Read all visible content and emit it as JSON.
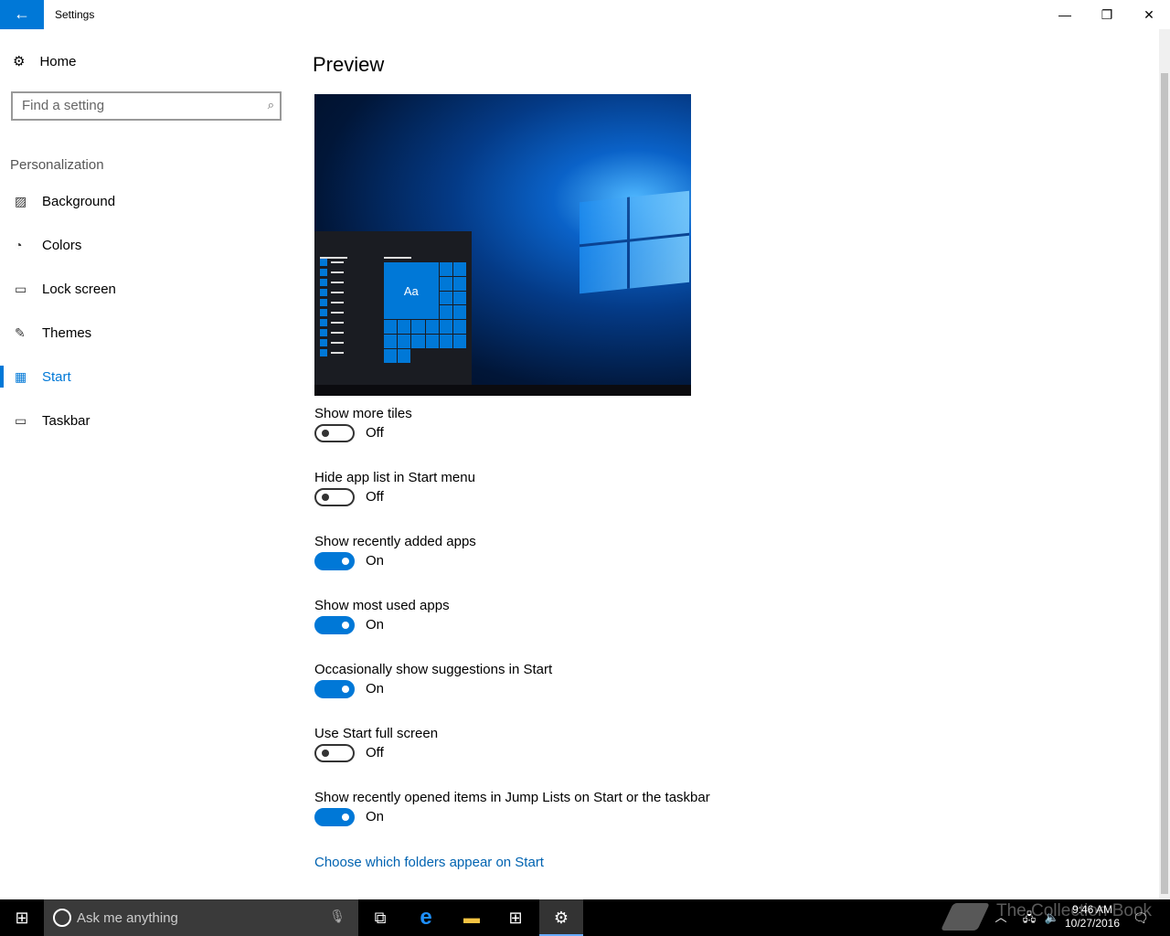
{
  "window": {
    "title": "Settings",
    "back_icon": "arrow-left-icon",
    "minimize": "—",
    "restore": "❐",
    "close": "✕"
  },
  "sidebar": {
    "home": "Home",
    "search_placeholder": "Find a setting",
    "section": "Personalization",
    "items": [
      {
        "label": "Background",
        "icon": "image-icon",
        "glyph": "▨"
      },
      {
        "label": "Colors",
        "icon": "palette-icon",
        "glyph": "◔"
      },
      {
        "label": "Lock screen",
        "icon": "lock-screen-icon",
        "glyph": "▭"
      },
      {
        "label": "Themes",
        "icon": "themes-icon",
        "glyph": "✎"
      },
      {
        "label": "Start",
        "icon": "start-icon",
        "glyph": "▦",
        "active": true
      },
      {
        "label": "Taskbar",
        "icon": "taskbar-icon",
        "glyph": "▭"
      }
    ]
  },
  "main": {
    "title": "Preview",
    "preview_tile_text": "Aa",
    "options": [
      {
        "label": "Show more tiles",
        "state": "Off"
      },
      {
        "label": "Hide app list in Start menu",
        "state": "Off"
      },
      {
        "label": "Show recently added apps",
        "state": "On"
      },
      {
        "label": "Show most used apps",
        "state": "On"
      },
      {
        "label": "Occasionally show suggestions in Start",
        "state": "On"
      },
      {
        "label": "Use Start full screen",
        "state": "Off"
      },
      {
        "label": "Show recently opened items in Jump Lists on Start or the taskbar",
        "state": "On"
      }
    ],
    "link": "Choose which folders appear on Start"
  },
  "taskbar": {
    "search_placeholder": "Ask me anything",
    "time": "9:46 AM",
    "date": "10/27/2016",
    "watermark": "The Collection Book"
  },
  "colors": {
    "accent": "#0078d7",
    "link": "#0063b1"
  }
}
